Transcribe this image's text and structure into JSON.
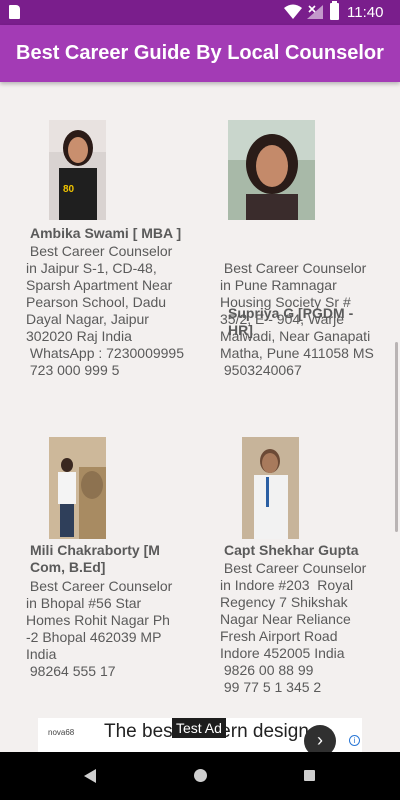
{
  "status_bar": {
    "time": "11:40",
    "icons": [
      "sd-card-icon",
      "wifi-icon",
      "signal-icon",
      "battery-icon"
    ]
  },
  "app_bar": {
    "title": "Best Career Guide By Local Counselor"
  },
  "counselors": [
    {
      "name": "Ambika Swami [ MBA ]",
      "info": " Best Career Counselor in Jaipur S-1, CD-48, Sparsh Apartment Near Pearson School, Dadu Dayal Nagar, Jaipur 302020 Raj India\n WhatsApp : 7230009995\n 723 000 999 5"
    },
    {
      "name": "Supriya G  [PGDM -HR]",
      "info": " Best Career Counselor in Pune Ramnagar Housing Society Sr # 35/2, E - 904, Warje Malwadi, Near Ganapati Matha, Pune 411058 MS\n 9503240067"
    },
    {
      "name": "Mili Chakraborty [M Com, B.Ed]",
      "info": " Best Career Counselor in Bhopal #56 Star Homes Rohit Nagar Ph -2 Bhopal 462039 MP India\n 98264 555 17"
    },
    {
      "name": "Capt Shekhar Gupta",
      "info": " Best Career Counselor in Indore #203  Royal Regency 7 Shikshak Nagar Near Reliance Fresh Airport Road Indore 452005 India\n 9826 00 88 99\n 99 77 5 1 345 2"
    }
  ],
  "ad": {
    "label": "Test Ad",
    "headline": "The best modern design",
    "logo_text": "nova68"
  },
  "colors": {
    "status_bar": "#7a1e8c",
    "app_bar": "#a33bb5",
    "background": "#f3f0ef",
    "text": "#5a5a5a"
  }
}
